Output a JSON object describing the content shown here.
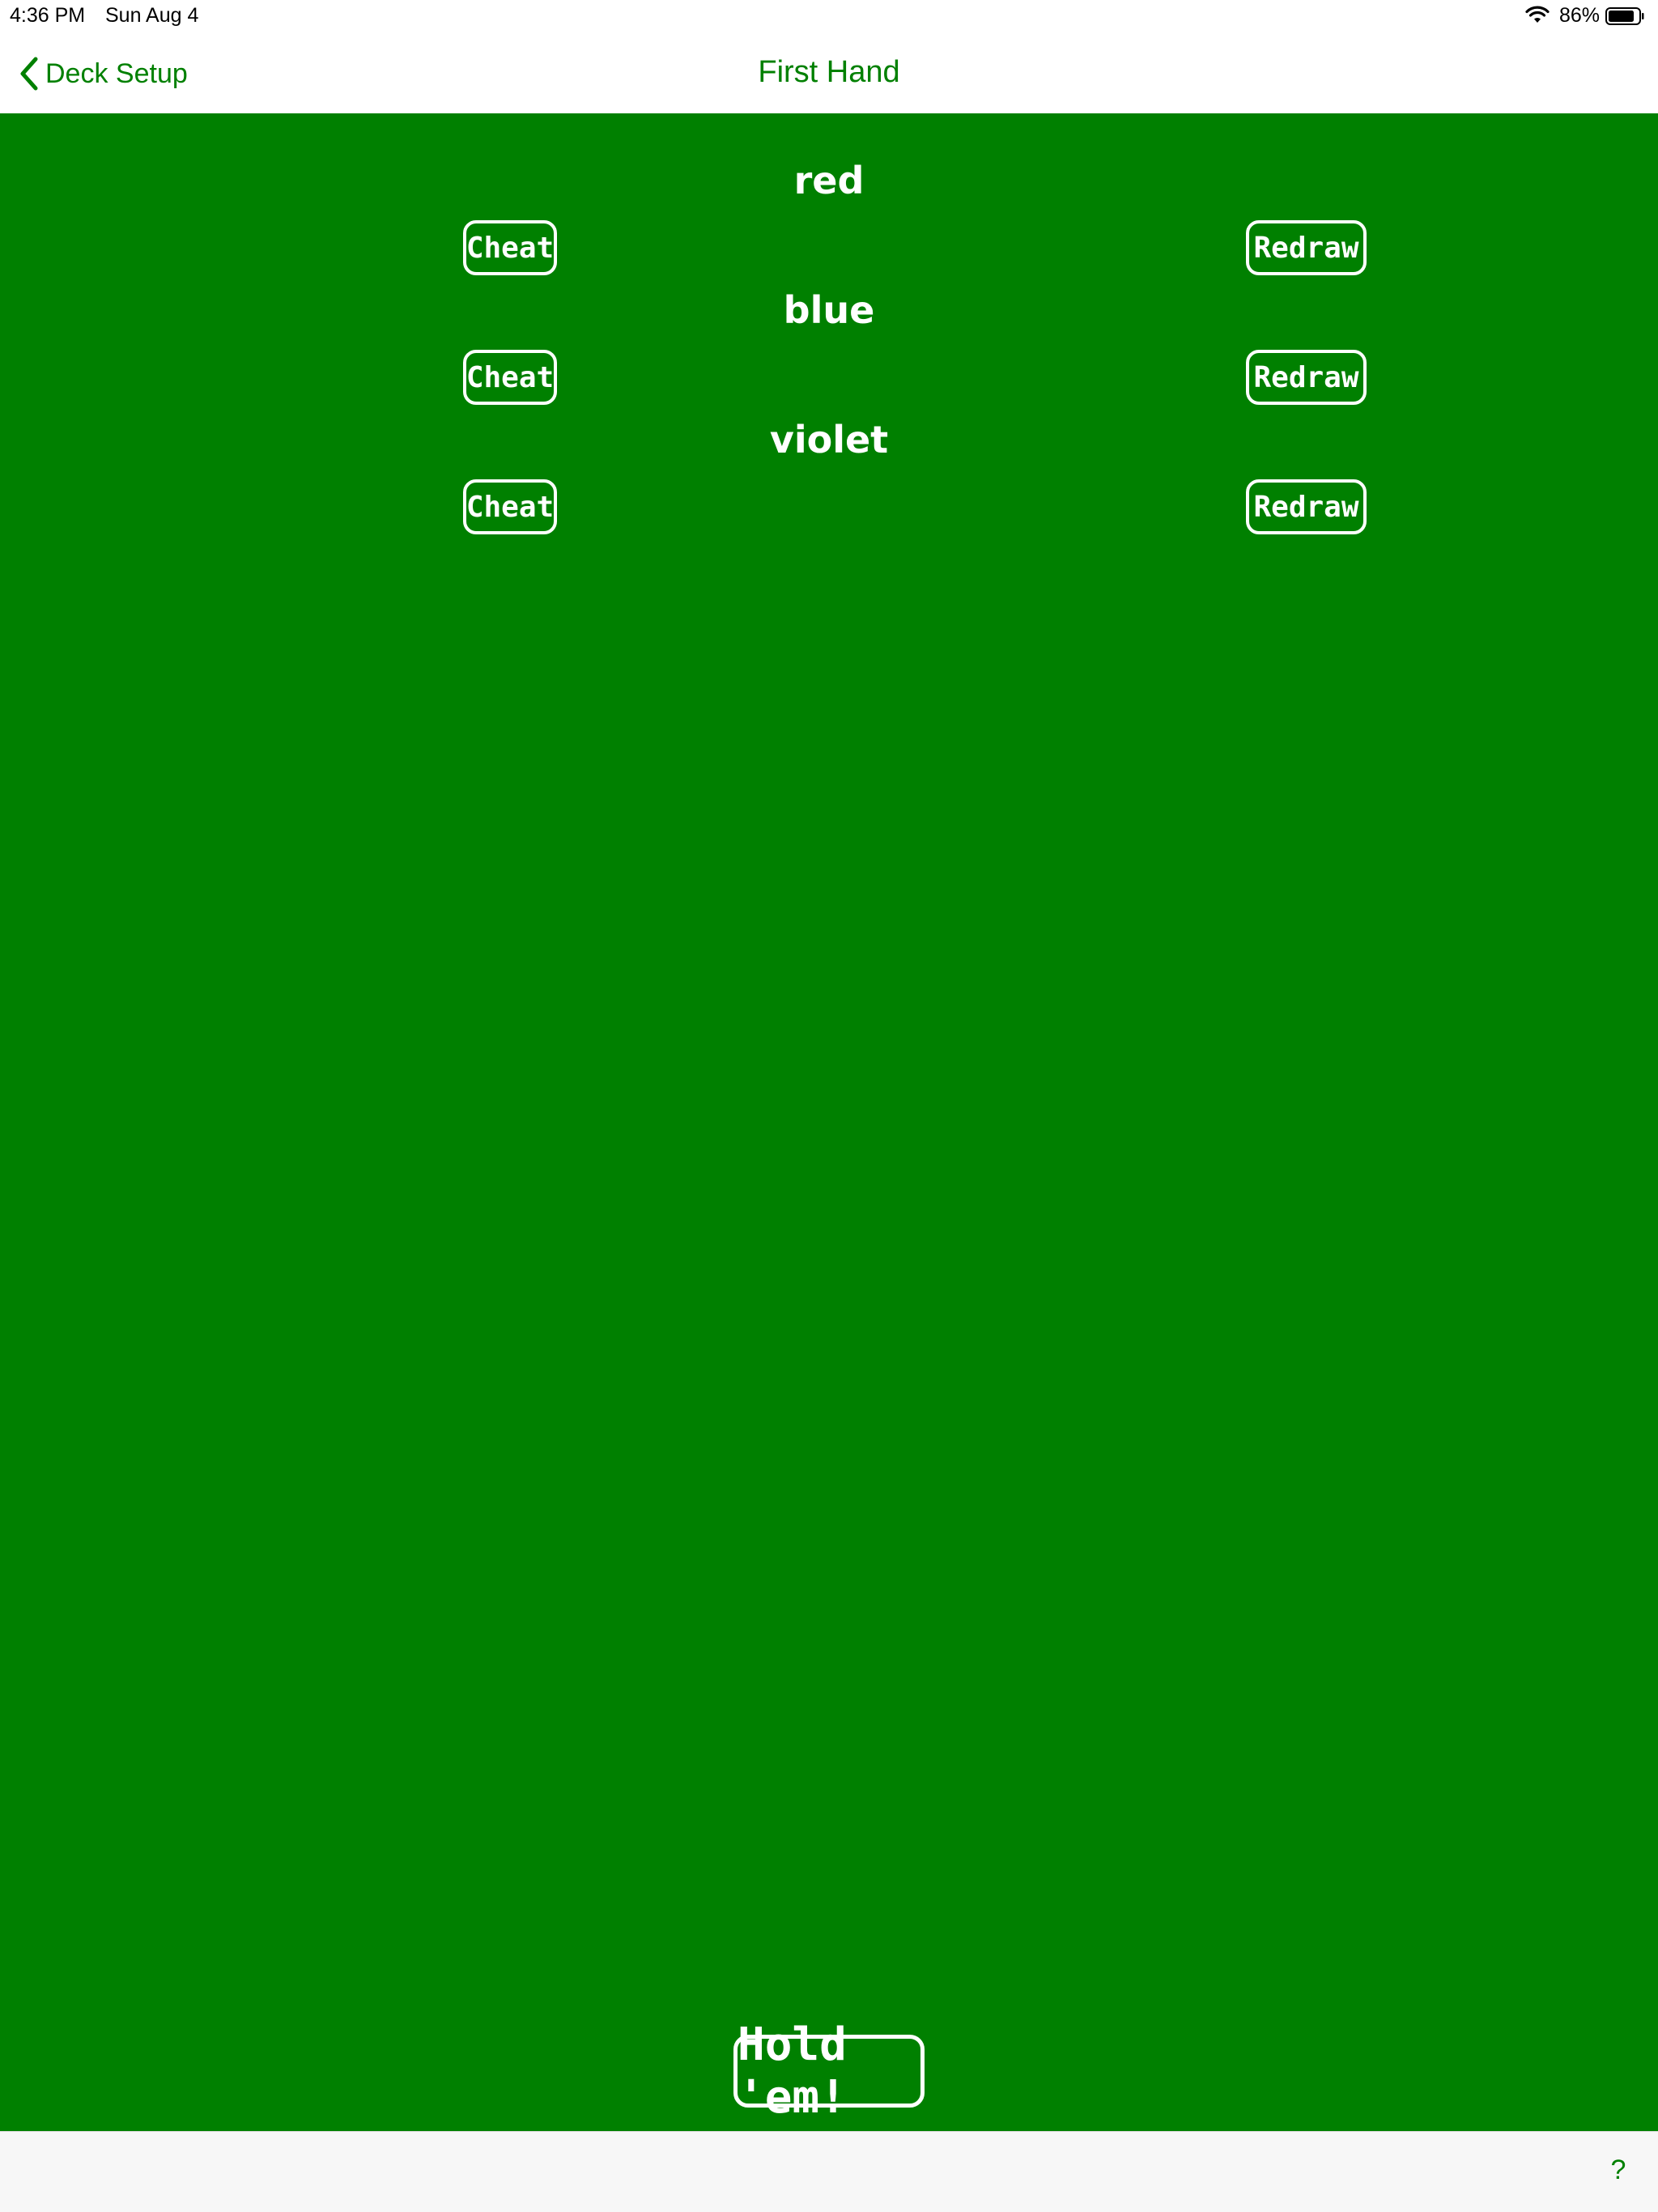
{
  "status_bar": {
    "time": "4:36 PM",
    "date": "Sun Aug 4",
    "battery_percent": "86%",
    "battery_level": 0.86,
    "icons": [
      "wifi-icon",
      "battery-icon"
    ]
  },
  "nav": {
    "back_label": "Deck Setup",
    "title": "First Hand",
    "tint_color": "#008000"
  },
  "table": {
    "background_color": "#008000",
    "cards": [
      {
        "label": "red",
        "cheat_label": "Cheat",
        "redraw_label": "Redraw"
      },
      {
        "label": "blue",
        "cheat_label": "Cheat",
        "redraw_label": "Redraw"
      },
      {
        "label": "violet",
        "cheat_label": "Cheat",
        "redraw_label": "Redraw"
      }
    ],
    "hold_label": "Hold 'em!"
  },
  "toolbar": {
    "help_label": "?"
  }
}
